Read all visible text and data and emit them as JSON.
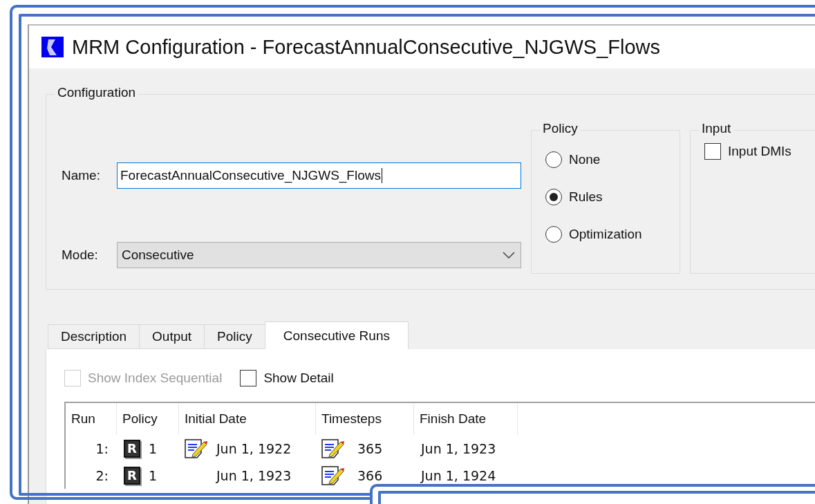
{
  "window": {
    "title": "MRM Configuration - ForecastAnnualConsecutive_NJGWS_Flows"
  },
  "configuration": {
    "label": "Configuration",
    "name": {
      "label": "Name:",
      "value": "ForecastAnnualConsecutive_NJGWS_Flows"
    },
    "mode": {
      "label": "Mode:",
      "value": "Consecutive"
    },
    "policy": {
      "label": "Policy",
      "options": [
        {
          "label": "None",
          "selected": false
        },
        {
          "label": "Rules",
          "selected": true
        },
        {
          "label": "Optimization",
          "selected": false
        }
      ]
    },
    "input": {
      "label": "Input",
      "checkboxes": [
        {
          "label": "Input DMIs",
          "checked": false
        }
      ]
    }
  },
  "tabs": [
    {
      "label": "Description",
      "selected": false
    },
    {
      "label": "Output",
      "selected": false
    },
    {
      "label": "Policy",
      "selected": false
    },
    {
      "label": "Consecutive Runs",
      "selected": true
    }
  ],
  "options": [
    {
      "label": "Show Index Sequential",
      "checked": false,
      "disabled": true
    },
    {
      "label": "Show Detail",
      "checked": false,
      "disabled": false
    }
  ],
  "table": {
    "columns": [
      "Run",
      "Policy",
      "Initial Date",
      "Timesteps",
      "Finish Date"
    ],
    "rows": [
      {
        "run": "1:",
        "policy_badge": "R",
        "policy": "1",
        "initial_date_icon": true,
        "initial_date": "Jun 1, 1922",
        "timesteps": "365",
        "finish_date": "Jun 1, 1923"
      },
      {
        "run": "2:",
        "policy_badge": "R",
        "policy": "1",
        "initial_date_icon": false,
        "initial_date": "Jun 1, 1923",
        "timesteps": "366",
        "finish_date": "Jun 1, 1924"
      }
    ]
  }
}
